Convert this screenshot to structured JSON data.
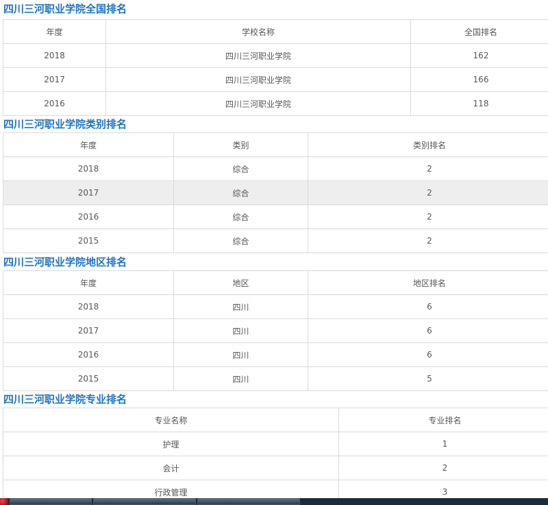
{
  "national": {
    "title": "四川三河职业学院全国排名",
    "headers": [
      "年度",
      "学校名称",
      "全国排名"
    ],
    "rows": [
      [
        "2018",
        "四川三河职业学院",
        "162"
      ],
      [
        "2017",
        "四川三河职业学院",
        "166"
      ],
      [
        "2016",
        "四川三河职业学院",
        "118"
      ]
    ]
  },
  "category": {
    "title": "四川三河职业学院类别排名",
    "headers": [
      "年度",
      "类别",
      "类别排名"
    ],
    "rows": [
      [
        "2018",
        "综合",
        "2"
      ],
      [
        "2017",
        "综合",
        "2"
      ],
      [
        "2016",
        "综合",
        "2"
      ],
      [
        "2015",
        "综合",
        "2"
      ]
    ]
  },
  "region": {
    "title": "四川三河职业学院地区排名",
    "headers": [
      "年度",
      "地区",
      "地区排名"
    ],
    "rows": [
      [
        "2018",
        "四川",
        "6"
      ],
      [
        "2017",
        "四川",
        "6"
      ],
      [
        "2016",
        "四川",
        "6"
      ],
      [
        "2015",
        "四川",
        "5"
      ]
    ]
  },
  "major": {
    "title": "四川三河职业学院专业排名",
    "headers": [
      "专业名称",
      "专业排名"
    ],
    "rows": [
      [
        "护理",
        "1"
      ],
      [
        "会计",
        "2"
      ],
      [
        "行政管理",
        "3"
      ]
    ]
  }
}
